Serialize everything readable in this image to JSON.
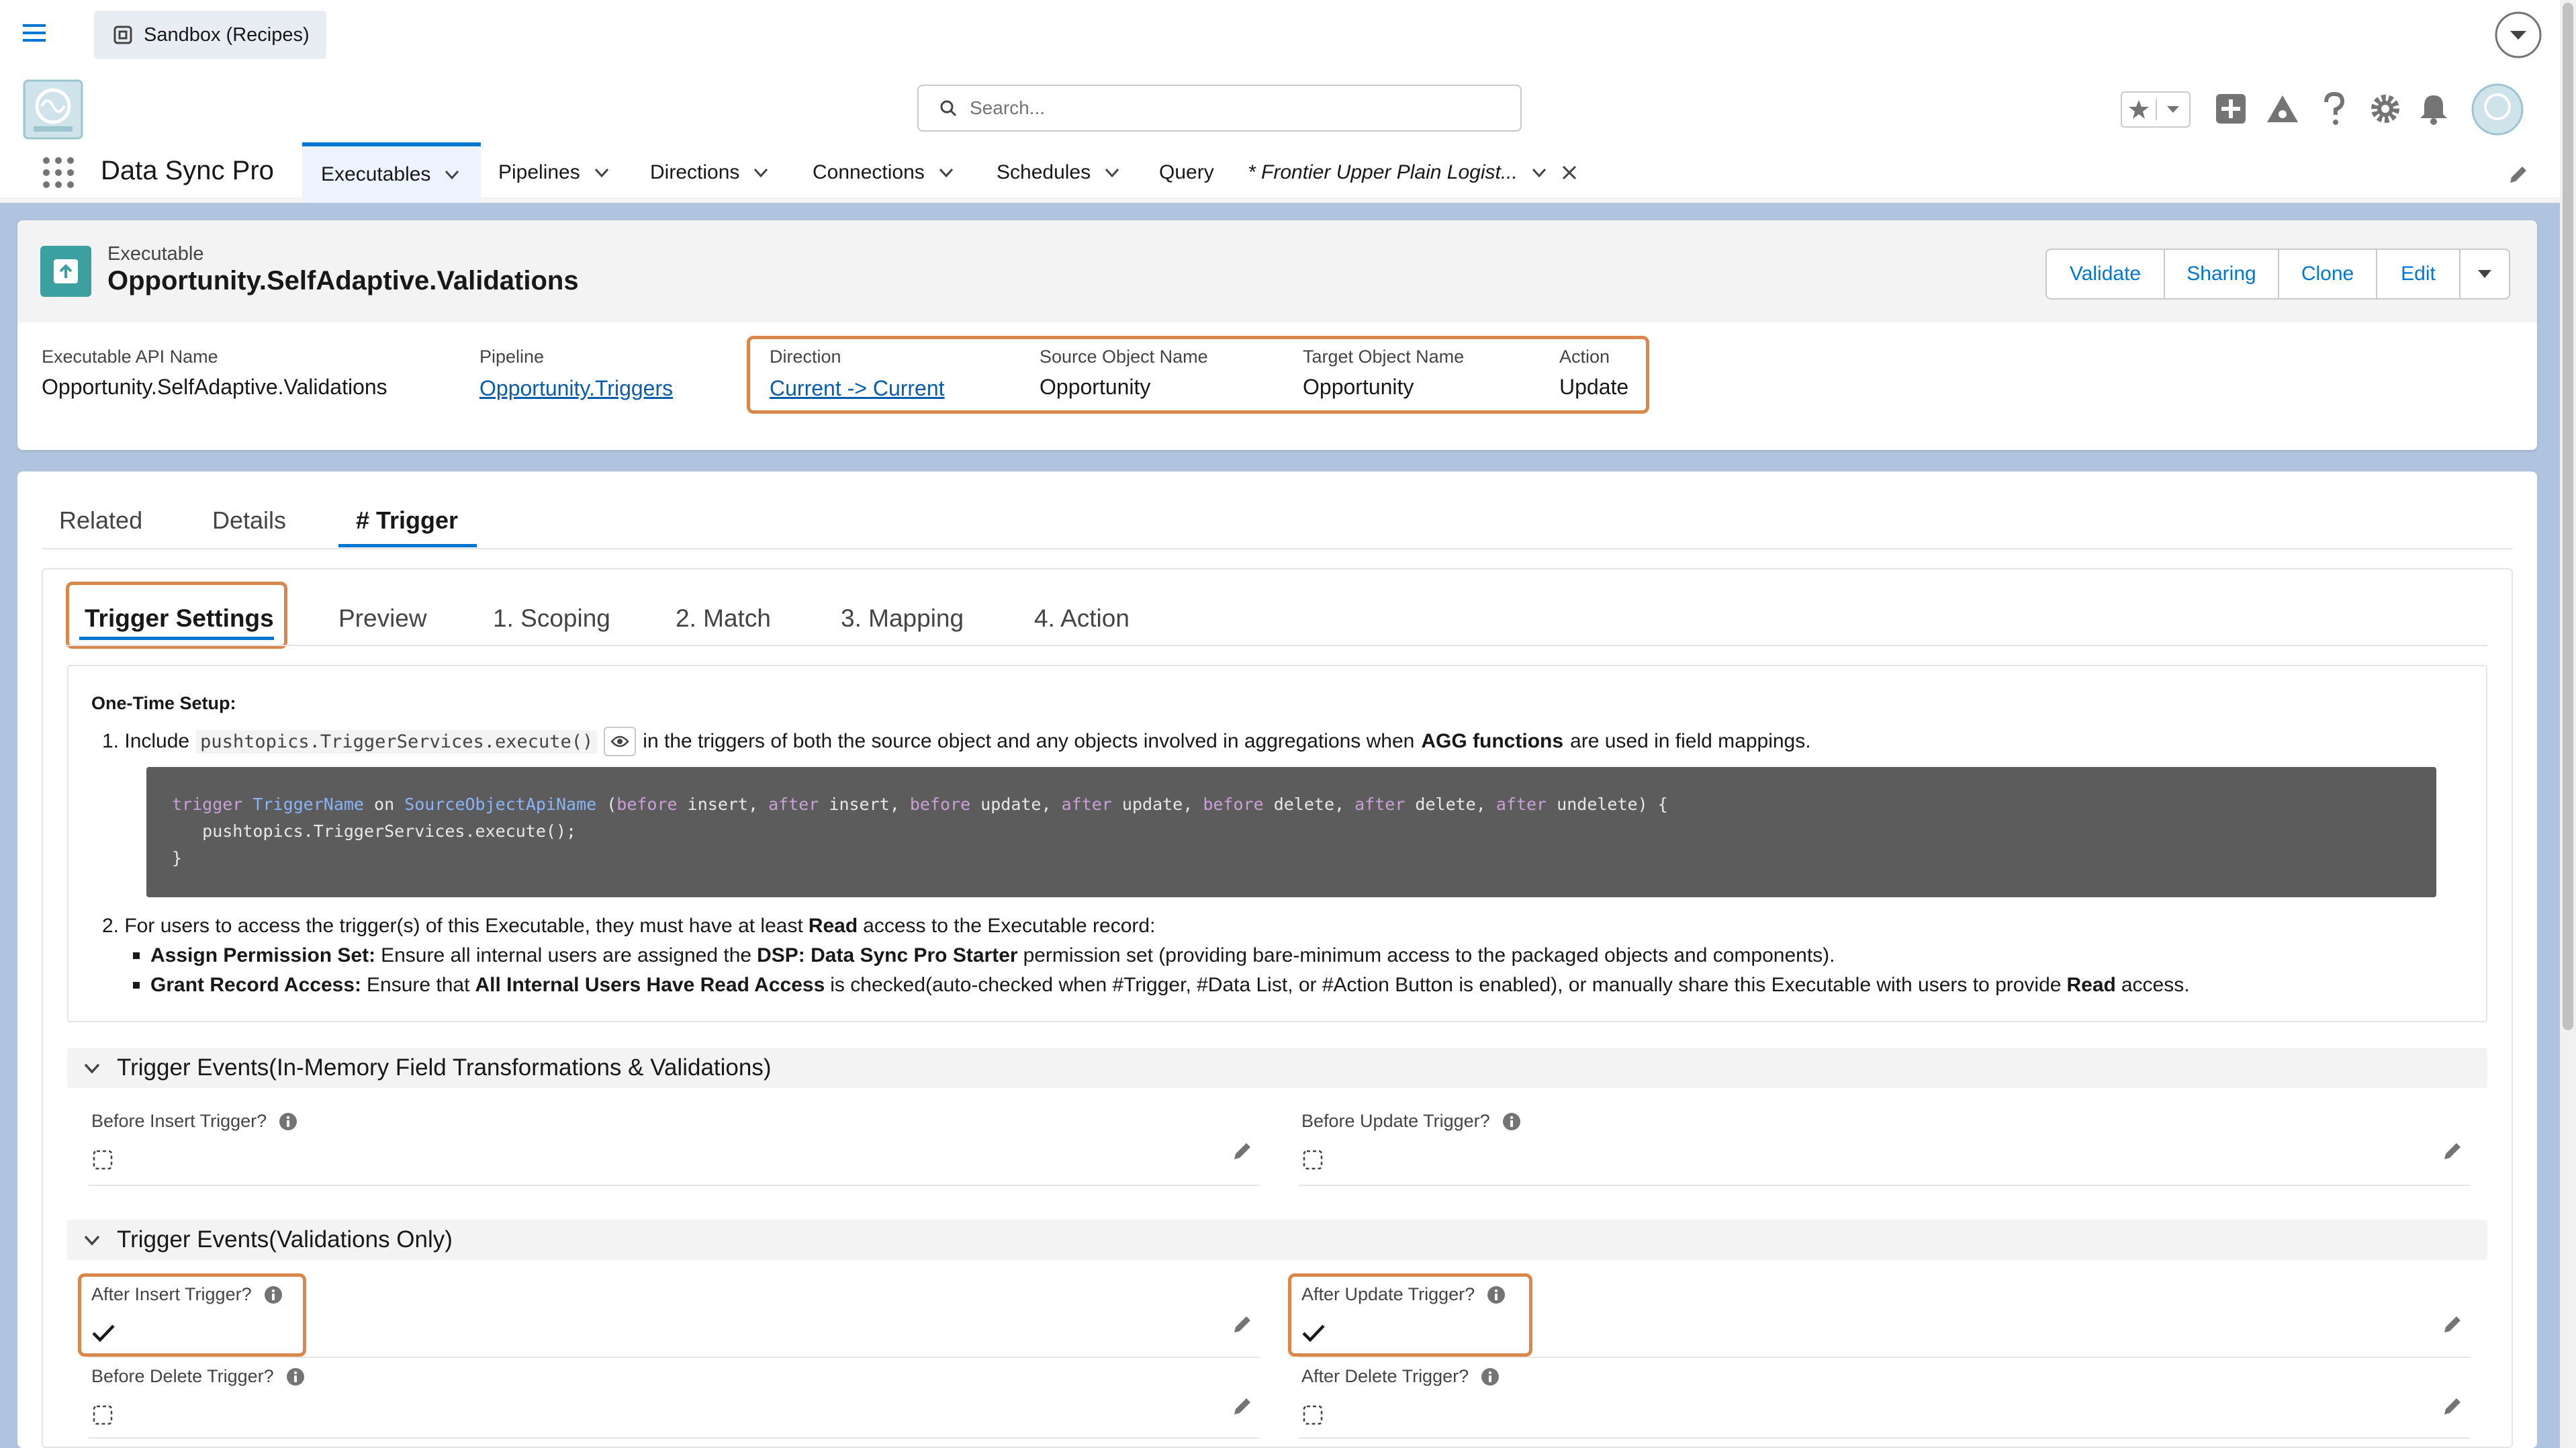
{
  "topbar": {
    "sandbox_label": "Sandbox (Recipes)"
  },
  "search": {
    "placeholder": "Search..."
  },
  "app": {
    "name": "Data Sync Pro"
  },
  "nav": {
    "tabs": [
      {
        "label": "Executables",
        "has_menu": true
      },
      {
        "label": "Pipelines",
        "has_menu": true
      },
      {
        "label": "Directions",
        "has_menu": true
      },
      {
        "label": "Connections",
        "has_menu": true
      },
      {
        "label": "Schedules",
        "has_menu": true
      },
      {
        "label": "Query",
        "has_menu": false
      },
      {
        "label": "* Frontier Upper Plain Logist...",
        "has_menu": true
      }
    ]
  },
  "record": {
    "object_label": "Executable",
    "title": "Opportunity.SelfAdaptive.Validations",
    "actions": [
      "Validate",
      "Sharing",
      "Clone",
      "Edit"
    ],
    "fields": [
      {
        "label": "Executable API Name",
        "value": "Opportunity.SelfAdaptive.Validations",
        "link": false
      },
      {
        "label": "Pipeline",
        "value": "Opportunity.Triggers",
        "link": true
      },
      {
        "label": "Direction",
        "value": "Current -> Current",
        "link": true
      },
      {
        "label": "Source Object Name",
        "value": "Opportunity",
        "link": false
      },
      {
        "label": "Target Object Name",
        "value": "Opportunity",
        "link": false
      },
      {
        "label": "Action",
        "value": "Update",
        "link": false
      }
    ]
  },
  "tabs": [
    "Related",
    "Details",
    "# Trigger"
  ],
  "subtabs": [
    "Trigger Settings",
    "Preview",
    "1. Scoping",
    "2. Match",
    "3. Mapping",
    "4. Action"
  ],
  "setup": {
    "heading": "One-Time Setup:",
    "step1_prefix": "1. Include",
    "step1_code": "pushtopics.TriggerServices.execute()",
    "step1_suffix_a": "in the triggers of both the source object and any objects involved in aggregations when",
    "step1_bold": "AGG functions",
    "step1_suffix_b": "are used in field mappings.",
    "code_line1_parts": [
      "trigger",
      " TriggerName",
      " on ",
      "SourceObjectApiName",
      " (",
      "before",
      " insert, ",
      "after",
      " insert, ",
      "before",
      " update, ",
      "after",
      " update, ",
      "before",
      " delete, ",
      "after",
      " delete, ",
      "after",
      " undelete) {"
    ],
    "code_line2": "   pushtopics.TriggerServices.execute();",
    "code_line3": "}",
    "step2_a": "2. For users to access the trigger(s) of this Executable, they must have at least",
    "step2_bold": "Read",
    "step2_b": "access to the Executable record:",
    "bullet1_bold": "Assign Permission Set:",
    "bullet1_a": "Ensure all internal users are assigned the",
    "bullet1_bold2": "DSP: Data Sync Pro Starter",
    "bullet1_b": "permission set (providing bare-minimum access to the packaged objects and components).",
    "bullet2_bold": "Grant Record Access:",
    "bullet2_a": "Ensure that",
    "bullet2_bold2": "All Internal Users Have Read Access",
    "bullet2_b": "is checked(auto-checked when #Trigger, #Data List, or #Action Button is enabled), or manually share this Executable with users to provide",
    "bullet2_bold3": "Read",
    "bullet2_c": "access."
  },
  "sections": [
    {
      "title": "Trigger Events(In-Memory Field Transformations & Validations)",
      "fields": [
        {
          "label": "Before Insert Trigger?",
          "checked": false
        },
        {
          "label": "Before Update Trigger?",
          "checked": false
        }
      ]
    },
    {
      "title": "Trigger Events(Validations Only)",
      "fields": [
        {
          "label": "After Insert Trigger?",
          "checked": true
        },
        {
          "label": "After Update Trigger?",
          "checked": true
        },
        {
          "label": "Before Delete Trigger?",
          "checked": false
        },
        {
          "label": "After Delete Trigger?",
          "checked": false
        }
      ]
    }
  ],
  "colors": {
    "brand_blue": "#0176d3",
    "highlight_orange": "#d9874a",
    "header_band": "#b0c4df"
  }
}
